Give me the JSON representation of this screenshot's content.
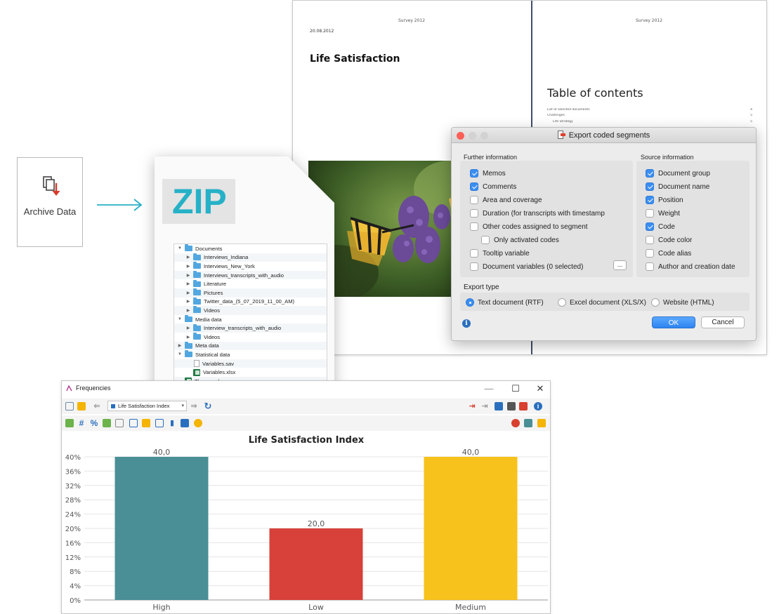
{
  "archive_button": {
    "label": "Archive Data"
  },
  "document_pages": {
    "left_page": {
      "header": "Survey 2012",
      "date": "20.08.2012",
      "title": "Life Satisfaction"
    },
    "right_page": {
      "header": "Survey 2012",
      "toc_title": "Table of contents",
      "toc_entries": [
        {
          "text": "List of selected documents",
          "page": "4"
        },
        {
          "text": "Challenges",
          "page": "5"
        },
        {
          "text": "Life Strategy",
          "page": "5"
        }
      ]
    }
  },
  "export_dialog": {
    "title": "Export coded segments",
    "further_info_heading": "Further information",
    "source_info_heading": "Source information",
    "further_info_options": [
      {
        "label": "Memos",
        "checked": true
      },
      {
        "label": "Comments",
        "checked": true
      },
      {
        "label": "Area and coverage",
        "checked": false
      },
      {
        "label": "Duration (for transcripts with timestamp",
        "checked": false
      },
      {
        "label": "Other codes assigned to segment",
        "checked": false
      },
      {
        "label": "Only activated codes",
        "checked": false
      },
      {
        "label": "Tooltip variable",
        "checked": false
      },
      {
        "label": "Document variables (0 selected)",
        "checked": false
      }
    ],
    "source_info_options": [
      {
        "label": "Document group",
        "checked": true
      },
      {
        "label": "Document name",
        "checked": true
      },
      {
        "label": "Position",
        "checked": true
      },
      {
        "label": "Weight",
        "checked": false
      },
      {
        "label": "Code",
        "checked": true
      },
      {
        "label": "Code color",
        "checked": false
      },
      {
        "label": "Code alias",
        "checked": false
      },
      {
        "label": "Author and creation date",
        "checked": false
      }
    ],
    "ellipsis_label": "...",
    "export_type_label": "Export type",
    "export_types": [
      {
        "label": "Text document (RTF)",
        "selected": true
      },
      {
        "label": "Excel document (XLS/X)",
        "selected": false
      },
      {
        "label": "Website (HTML)",
        "selected": false
      }
    ],
    "ok_label": "OK",
    "cancel_label": "Cancel",
    "accent_color": "#3b8ef0"
  },
  "zip_card": {
    "label": "ZIP",
    "label_color": "#26b1c7",
    "tree": [
      {
        "label": "Documents",
        "type": "folder",
        "level": 0,
        "state": "expanded"
      },
      {
        "label": "Interviews_Indiana",
        "type": "folder",
        "level": 1,
        "state": "collapsed"
      },
      {
        "label": "Interviews_New_York",
        "type": "folder",
        "level": 1,
        "state": "collapsed"
      },
      {
        "label": "Interviews_transcripts_with_audio",
        "type": "folder",
        "level": 1,
        "state": "collapsed"
      },
      {
        "label": "Literature",
        "type": "folder",
        "level": 1,
        "state": "collapsed"
      },
      {
        "label": "Pictures",
        "type": "folder",
        "level": 1,
        "state": "collapsed"
      },
      {
        "label": "Twitter_data_(5_07_2019_11_00_AM)",
        "type": "folder",
        "level": 1,
        "state": "collapsed"
      },
      {
        "label": "Videos",
        "type": "folder",
        "level": 1,
        "state": "collapsed"
      },
      {
        "label": "Media data",
        "type": "folder",
        "level": 0,
        "state": "expanded"
      },
      {
        "label": "Interview_transcripts_with_audio",
        "type": "folder",
        "level": 1,
        "state": "collapsed"
      },
      {
        "label": "Videos",
        "type": "folder",
        "level": 1,
        "state": "collapsed"
      },
      {
        "label": "Meta data",
        "type": "folder",
        "level": 0,
        "state": "collapsed"
      },
      {
        "label": "Statistical data",
        "type": "folder",
        "level": 0,
        "state": "expanded"
      },
      {
        "label": "Variables.sav",
        "type": "file",
        "level": 1,
        "state": "none"
      },
      {
        "label": "Variables.xlsx",
        "type": "xlsx",
        "level": 1,
        "state": "none"
      },
      {
        "label": "Themes.xlsx",
        "type": "xlsx",
        "level": 0,
        "state": "none"
      }
    ]
  },
  "frequencies_window": {
    "title": "Frequencies",
    "variable_selector": "Life Satisfaction Index",
    "window_controls": {
      "minimize": "—",
      "maximize": "☐",
      "close": "✕"
    }
  },
  "chart_data": {
    "type": "bar",
    "title": "Life Satisfaction Index",
    "categories": [
      "High",
      "Low",
      "Medium"
    ],
    "values": [
      40,
      20,
      40
    ],
    "data_labels": [
      "40,0",
      "20,0",
      "40,0"
    ],
    "colors": [
      "#4a8f96",
      "#d7413a",
      "#f7c21b"
    ],
    "y_ticks": [
      "0%",
      "4%",
      "8%",
      "12%",
      "16%",
      "20%",
      "24%",
      "28%",
      "32%",
      "36%",
      "40%"
    ],
    "ylim": [
      0,
      40
    ],
    "y_unit": "%",
    "grid": true,
    "legend": "none"
  }
}
